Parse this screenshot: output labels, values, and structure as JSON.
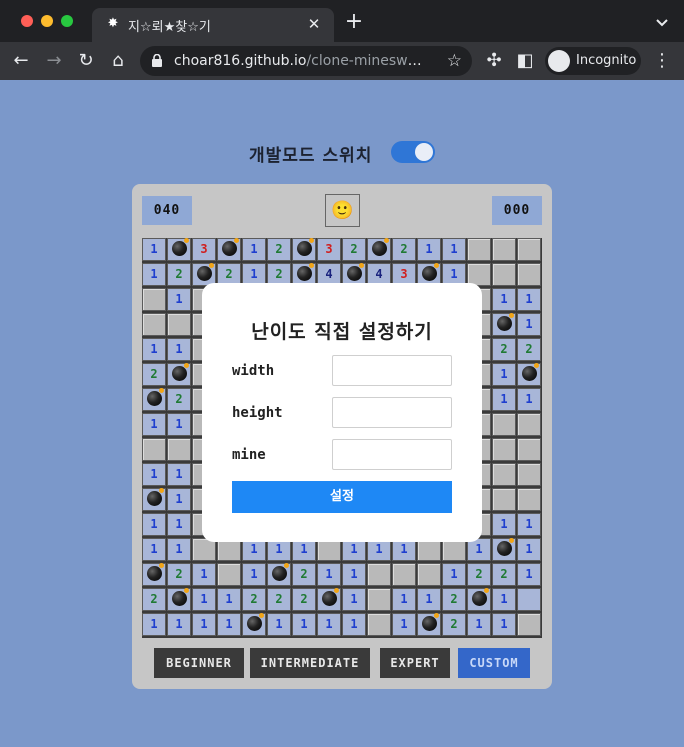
{
  "browser": {
    "tab_title": "지☆뢰★찾☆기",
    "url_host": "choar816.github.io",
    "url_path": "/clone-minesweep...",
    "incognito_label": "Incognito"
  },
  "dev_mode": {
    "label": "개발모드 스위치",
    "enabled": true
  },
  "game": {
    "mine_counter": "040",
    "timer": "000",
    "face": "🙂",
    "rows": [
      [
        "1",
        "B",
        "3",
        "B",
        "1",
        "2",
        "B",
        "3",
        "2",
        "B",
        "2",
        "1",
        "1",
        "",
        "",
        ""
      ],
      [
        "1",
        "2",
        "B",
        "2",
        "1",
        "2",
        "B",
        "4",
        "B",
        "4",
        "3",
        "B",
        "1",
        "",
        "",
        ""
      ],
      [
        "",
        "1",
        "",
        "",
        "",
        "",
        "",
        "",
        "",
        "",
        "",
        "",
        "",
        "",
        "1",
        "1"
      ],
      [
        "",
        "",
        "",
        "",
        "",
        "",
        "",
        "",
        "",
        "",
        "",
        "",
        "",
        "",
        "B",
        "1"
      ],
      [
        "1",
        "1",
        "",
        "",
        "",
        "",
        "",
        "",
        "",
        "",
        "",
        "",
        "",
        "",
        "2",
        "2"
      ],
      [
        "2",
        "B",
        "",
        "",
        "",
        "",
        "",
        "",
        "",
        "",
        "",
        "",
        "",
        "",
        "1",
        "B"
      ],
      [
        "B",
        "2",
        "",
        "",
        "",
        "",
        "",
        "",
        "",
        "",
        "",
        "",
        "",
        "",
        "1",
        "1"
      ],
      [
        "1",
        "1",
        "",
        "",
        "",
        "",
        "",
        "",
        "",
        "",
        "",
        "",
        "",
        "",
        "",
        ""
      ],
      [
        "",
        "",
        "",
        "",
        "",
        "",
        "",
        "",
        "",
        "",
        "",
        "",
        "",
        "",
        "",
        ""
      ],
      [
        "1",
        "1",
        "",
        "",
        "",
        "",
        "",
        "",
        "",
        "",
        "",
        "",
        "",
        "",
        "",
        ""
      ],
      [
        "B",
        "1",
        "",
        "",
        "",
        "",
        "",
        "",
        "",
        "",
        "",
        "",
        "",
        "",
        "",
        ""
      ],
      [
        "1",
        "1",
        "",
        "",
        "",
        "",
        "",
        "",
        "",
        "",
        "",
        "",
        "",
        "",
        "1",
        "1"
      ],
      [
        "1",
        "1",
        "",
        "",
        "1",
        "1",
        "1",
        "",
        "1",
        "1",
        "1",
        "",
        "",
        "1",
        "B",
        "1"
      ],
      [
        "B",
        "2",
        "1",
        "",
        "1",
        "B",
        "2",
        "1",
        "1",
        "",
        "",
        "",
        "1",
        "2",
        "2",
        "1"
      ],
      [
        "2",
        "B",
        "1",
        "1",
        "2",
        "2",
        "2",
        "B",
        "1",
        "",
        "1",
        "1",
        "2",
        "B",
        "1",
        ""
      ],
      [
        "1",
        "1",
        "1",
        "1",
        "B",
        "1",
        "1",
        "1",
        "1",
        "",
        "1",
        "B",
        "2",
        "1",
        "1",
        ""
      ]
    ],
    "open_mask": [
      "1111111111111000",
      "1111111111111000",
      "0100000000000011",
      "0000000000000011",
      "1100000000000011",
      "1100000000000011",
      "1100000000000011",
      "1100000000000000",
      "0000000000000000",
      "1100000000000000",
      "1100000000000000",
      "1100000000000011",
      "1100111011100111",
      "1110111110001111",
      "1111111110111111",
      "1111111110111110"
    ],
    "levels": [
      "BEGINNER",
      "INTERMEDIATE",
      "EXPERT",
      "CUSTOM"
    ],
    "active_level": "CUSTOM"
  },
  "modal": {
    "title": "난이도 직접 설정하기",
    "width_label": "width",
    "height_label": "height",
    "mine_label": "mine",
    "width_value": "",
    "height_value": "",
    "mine_value": "",
    "submit_label": "설정"
  }
}
